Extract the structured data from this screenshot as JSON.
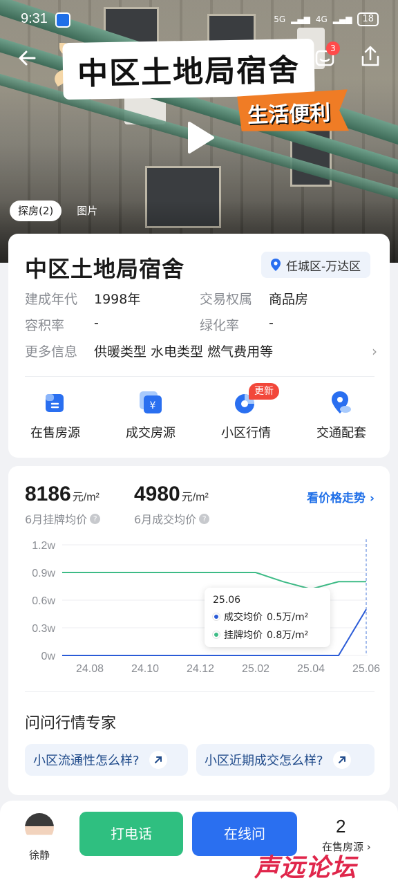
{
  "status_bar": {
    "time": "9:31",
    "network": "5G",
    "network2": "4G",
    "battery": "18"
  },
  "hero": {
    "overlay_title": "中区土地局宿舍",
    "overlay_subtitle": "生活便利",
    "message_badge": "3",
    "media_tabs": [
      {
        "label": "探房(2)",
        "active": true
      },
      {
        "label": "图片",
        "active": false
      }
    ]
  },
  "estate": {
    "name": "中区土地局宿舍",
    "location": "任城区-万达区",
    "attributes": [
      {
        "key": "建成年代",
        "value": "1998年"
      },
      {
        "key": "交易权属",
        "value": "商品房"
      },
      {
        "key": "容积率",
        "value": "-"
      },
      {
        "key": "绿化率",
        "value": "-"
      },
      {
        "key": "更多信息",
        "value": "供暖类型 水电类型 燃气费用等"
      }
    ],
    "quick_links": [
      {
        "label": "在售房源",
        "icon": "listing-icon"
      },
      {
        "label": "成交房源",
        "icon": "yuan-deal-icon"
      },
      {
        "label": "小区行情",
        "icon": "pie-chart-icon",
        "badge": "更新"
      },
      {
        "label": "交通配套",
        "icon": "map-pin-icon"
      }
    ]
  },
  "price": {
    "listing_avg": "8186",
    "listing_unit": "元/m²",
    "listing_label": "6月挂牌均价",
    "deal_avg": "4980",
    "deal_unit": "元/m²",
    "deal_label": "6月成交均价",
    "trend_link": "看价格走势"
  },
  "chart_data": {
    "type": "line",
    "x": [
      "24.07",
      "24.08",
      "24.09",
      "24.10",
      "24.11",
      "24.12",
      "25.01",
      "25.02",
      "25.03",
      "25.04",
      "25.05",
      "25.06"
    ],
    "x_tick_labels": [
      "24.08",
      "24.10",
      "24.12",
      "25.02",
      "25.04",
      "25.06"
    ],
    "y_tick_labels": [
      "1.2w",
      "0.9w",
      "0.6w",
      "0.3w",
      "0w"
    ],
    "ylim": [
      0,
      1.2
    ],
    "series": [
      {
        "name": "挂牌均价",
        "color": "#3dbb86",
        "values": [
          0.9,
          0.9,
          0.9,
          0.9,
          0.9,
          0.9,
          0.9,
          0.9,
          0.8,
          0.72,
          0.8,
          0.8
        ]
      },
      {
        "name": "成交均价",
        "color": "#2a5bd7",
        "values": [
          0,
          0,
          0,
          0,
          0,
          0,
          0,
          0,
          0,
          0,
          0,
          0.5
        ]
      }
    ],
    "tooltip": {
      "title": "25.06",
      "rows": [
        {
          "name": "成交均价",
          "value": "0.5万/m²",
          "color": "#2a5bd7"
        },
        {
          "name": "挂牌均价",
          "value": "0.8万/m²",
          "color": "#3dbb86"
        }
      ]
    },
    "grid": true
  },
  "ask": {
    "title": "问问行情专家",
    "chips": [
      "小区流通性怎么样?",
      "小区近期成交怎么样?"
    ]
  },
  "bottom": {
    "agent_name": "徐静",
    "call_label": "打电话",
    "online_label": "在线问",
    "onsale_count": "2",
    "onsale_label": "在售房源"
  },
  "watermark": "声远论坛",
  "colors": {
    "primary": "#2a6ff0",
    "green": "#2fbf80",
    "badge_red": "#f2473a"
  }
}
